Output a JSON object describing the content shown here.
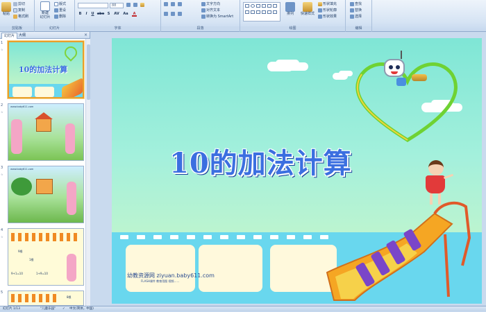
{
  "ribbon": {
    "clipboard": {
      "label": "剪贴板",
      "paste": "粘贴",
      "cut": "剪切",
      "copy": "复制",
      "format_painter": "格式刷"
    },
    "slides": {
      "label": "幻灯片",
      "new_slide": "新建\n幻灯片",
      "layout": "版式",
      "reset": "重设",
      "delete": "删除"
    },
    "font": {
      "label": "字体",
      "size": "88",
      "bold": "B",
      "italic": "I",
      "underline": "U",
      "strike": "abe",
      "shadow": "S",
      "spacing": "AV",
      "case": "Aa",
      "color": "A"
    },
    "paragraph": {
      "label": "段落",
      "text_direction": "文字方向",
      "align_text": "对齐文本",
      "smartart": "转换为 SmartArt"
    },
    "drawing": {
      "label": "绘图",
      "arrange": "排列",
      "quick_styles": "快速样式",
      "shape_fill": "形状填充",
      "shape_outline": "形状轮廓",
      "shape_effects": "形状效果"
    },
    "editing": {
      "label": "编辑",
      "find": "查找",
      "replace": "替换",
      "select": "选择"
    }
  },
  "panel": {
    "tabs": [
      "幻灯片",
      "大纲"
    ],
    "close": "×",
    "thumbnails": [
      {
        "num": "1",
        "anim": "☆",
        "title": "10的加法计算"
      },
      {
        "num": "2",
        "anim": "☆",
        "url": "www.baby611.com"
      },
      {
        "num": "3",
        "anim": "☆",
        "url": "www.baby611.com"
      },
      {
        "num": "4",
        "anim": "☆",
        "labels": [
          "9根",
          "1根",
          "9+1=10",
          "1+9=10"
        ]
      },
      {
        "num": "5",
        "anim": "",
        "labels": [
          "8根"
        ]
      }
    ]
  },
  "slide": {
    "title": "10的加法计算",
    "watermark": "幼教资源网 ziyuan.baby611.com",
    "watermark_sub": "FLASH课件  教育用图  视频……"
  },
  "status": {
    "slide_num": "幻灯片 1/13",
    "theme": "\"儿童乐园\"",
    "language": "中文(简体，中国)"
  },
  "colors": {
    "ribbon": "#d6e4f4",
    "slide_top": "#7fe6d6",
    "title": "#3b6fe0",
    "film": "#69d7ee"
  }
}
